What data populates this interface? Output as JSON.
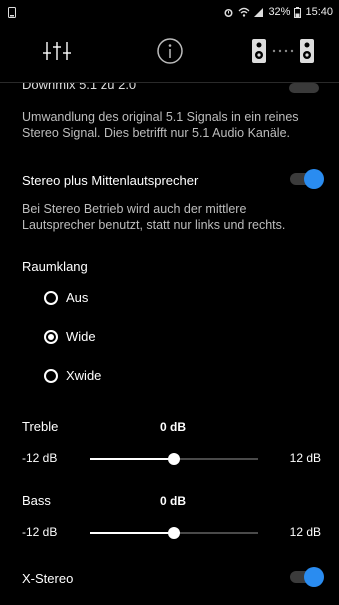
{
  "status": {
    "battery": "32%",
    "time": "15:40"
  },
  "tabs": [
    {
      "icon": "equalizer-icon"
    },
    {
      "icon": "info-icon"
    },
    {
      "icon": "speakers-icon"
    }
  ],
  "settings": {
    "downmix": {
      "title_cut": "Downmix 5.1 zu 2.0",
      "description": "Umwandlung des original 5.1 Signals in ein reines Stereo Signal. Dies betrifft nur 5.1 Audio Kanäle."
    },
    "center": {
      "title": "Stereo plus Mittenlautsprecher",
      "description": "Bei Stereo Betrieb wird auch der mittlere Lautsprecher benutzt, statt nur links und rechts.",
      "enabled": true
    },
    "raumklang": {
      "title": "Raumklang",
      "options": [
        "Aus",
        "Wide",
        "Xwide"
      ],
      "selected": "Wide"
    },
    "treble": {
      "label": "Treble",
      "value": "0 dB",
      "min": "-12 dB",
      "max": "12 dB",
      "level": 0.5
    },
    "bass": {
      "label": "Bass",
      "value": "0 dB",
      "min": "-12 dB",
      "max": "12 dB",
      "level": 0.5
    },
    "xstereo": {
      "title": "X-Stereo",
      "enabled": true
    }
  },
  "colors": {
    "accent": "#2a8cf0",
    "background": "#000000"
  }
}
